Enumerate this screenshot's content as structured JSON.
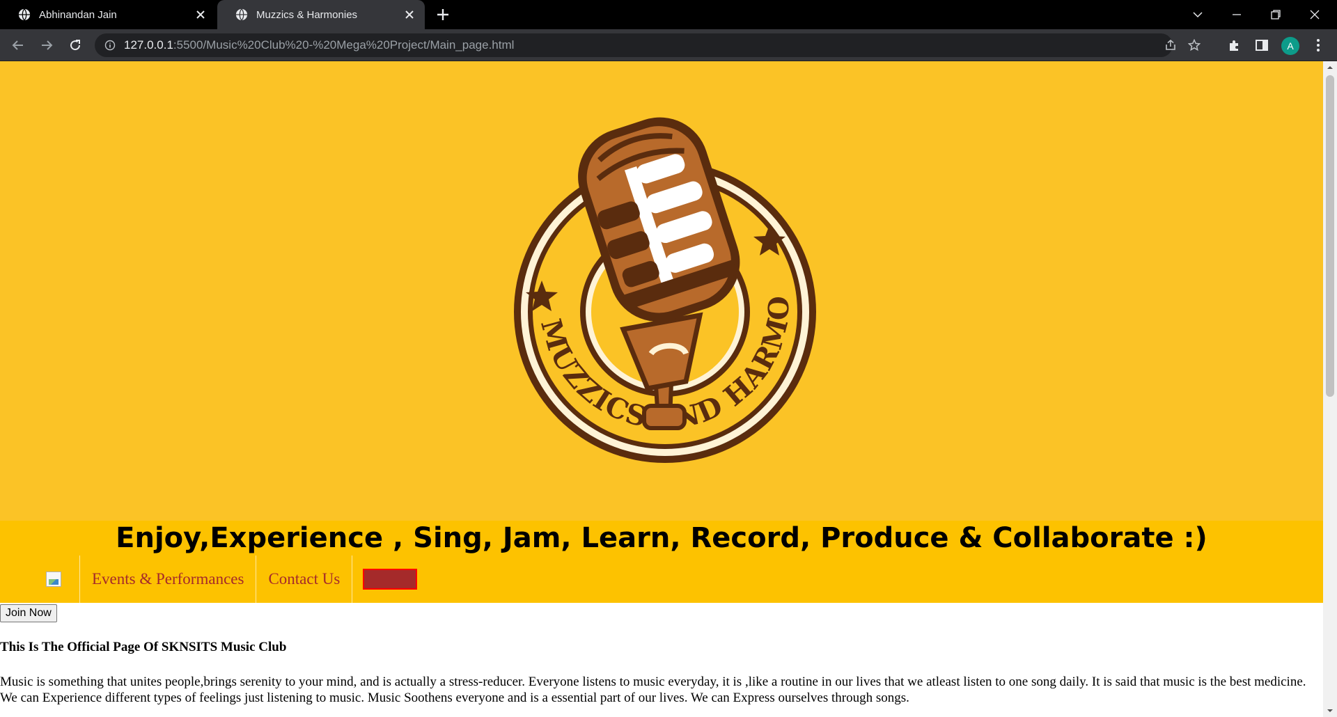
{
  "browser": {
    "tabs": [
      {
        "title": "Abhinandan Jain",
        "active": false
      },
      {
        "title": "Muzzics & Harmonies",
        "active": true
      }
    ],
    "url_host": "127.0.0.1",
    "url_rest": ":5500/Music%20Club%20-%20Mega%20Project/Main_page.html",
    "profile_initial": "A"
  },
  "page": {
    "logo": {
      "brand_text": "MUZZICS AND HARMONIES",
      "colors": {
        "outer": "#5a2c0e",
        "inner_cream": "#fff3d6",
        "mic_body": "#b86a2b",
        "mic_highlight": "#ffffff",
        "background": "#fbc326"
      }
    },
    "tagline": "Enjoy,Experience , Sing, Jam, Learn, Record, Produce & Collaborate :)",
    "nav": {
      "links": [
        "Events & Performances",
        "Contact Us"
      ],
      "link_color": "#a52a2a",
      "bar_color": "#fdc200"
    },
    "join_button_label": "Join Now",
    "heading": "This Is The Official Page Of SKNSITS Music Club",
    "paragraph": "Music is something that unites people,brings serenity to your mind, and is actually a stress-reducer. Everyone listens to music everyday, it is ,like a routine in our lives that we atleast listen to one song daily. It is said that music is the best medicine. We can Experience different types of feelings just listening to music. Music Soothens everyone and is a essential part of our lives. We can Express ourselves through songs."
  }
}
